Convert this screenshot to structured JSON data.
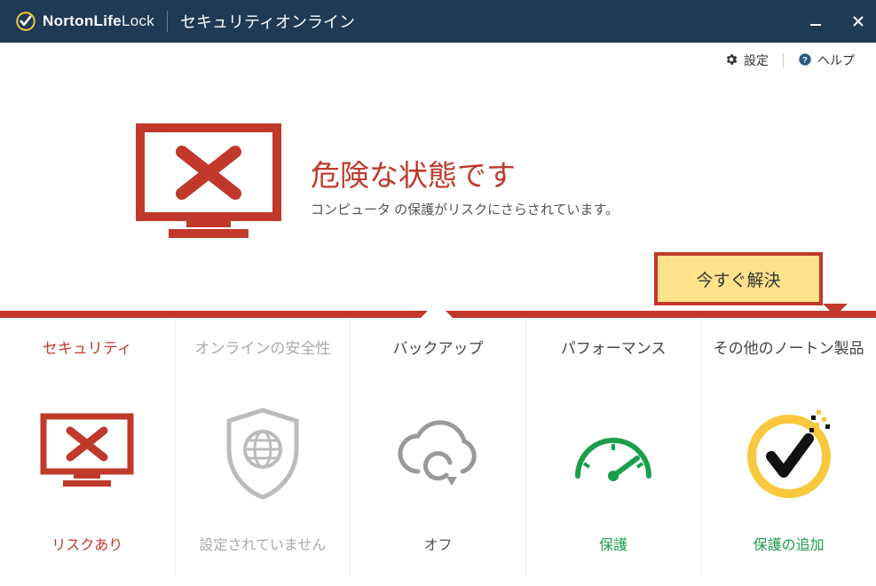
{
  "brand": {
    "bold": "NortonLife",
    "thin": "Lock"
  },
  "app_title": "セキュリティオンライン",
  "toolbar": {
    "settings": "設定",
    "help": "ヘルプ"
  },
  "status": {
    "headline": "危険な状態です",
    "sub": "コンピュータ の保護がリスクにさらされています。",
    "resolve": "今すぐ解決"
  },
  "tiles": [
    {
      "title": "セキュリティ",
      "status": "リスクあり"
    },
    {
      "title": "オンラインの安全性",
      "status": "設定されていません"
    },
    {
      "title": "バックアップ",
      "status": "オフ"
    },
    {
      "title": "パフォーマンス",
      "status": "保護"
    },
    {
      "title": "その他のノートン製品",
      "status": "保護の追加"
    }
  ]
}
